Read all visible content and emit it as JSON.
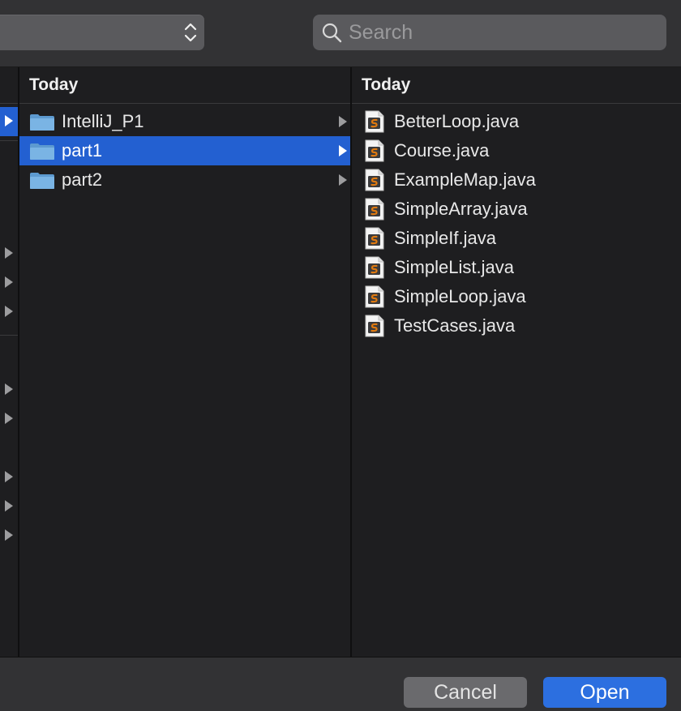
{
  "search": {
    "placeholder": "Search",
    "value": ""
  },
  "columns": {
    "middle": {
      "header": "Today",
      "items": [
        {
          "label": "IntelliJ_P1",
          "type": "folder",
          "selected": false
        },
        {
          "label": "part1",
          "type": "folder",
          "selected": true
        },
        {
          "label": "part2",
          "type": "folder",
          "selected": false
        }
      ]
    },
    "right": {
      "header": "Today",
      "items": [
        {
          "label": "BetterLoop.java",
          "type": "java-file"
        },
        {
          "label": "Course.java",
          "type": "java-file"
        },
        {
          "label": "ExampleMap.java",
          "type": "java-file"
        },
        {
          "label": "SimpleArray.java",
          "type": "java-file"
        },
        {
          "label": "SimpleIf.java",
          "type": "java-file"
        },
        {
          "label": "SimpleList.java",
          "type": "java-file"
        },
        {
          "label": "SimpleLoop.java",
          "type": "java-file"
        },
        {
          "label": "TestCases.java",
          "type": "java-file"
        }
      ]
    }
  },
  "buttons": {
    "cancel": "Cancel",
    "open": "Open"
  },
  "colors": {
    "selection": "#2360d1",
    "open_button": "#2c6fe0",
    "background": "#1e1e20",
    "folder": "#6fa8d8",
    "java_icon_accent": "#e07a10"
  },
  "icons": {
    "location_popup": "chevron-up-down-icon",
    "search": "magnifier-icon",
    "folder": "folder-icon",
    "file": "java-file-icon",
    "disclosure": "disclosure-arrow-icon"
  }
}
